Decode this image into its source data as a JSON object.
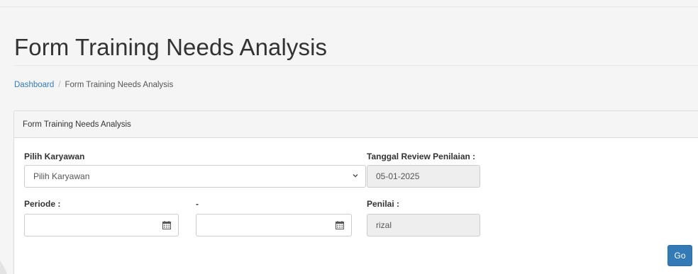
{
  "header": {
    "title": "Form Training Needs Analysis"
  },
  "breadcrumb": {
    "home": "Dashboard",
    "separator": "/",
    "current": "Form Training Needs Analysis"
  },
  "panel": {
    "heading": "Form Training Needs Analysis",
    "employee": {
      "label": "Pilih Karyawan",
      "selected": "Pilih Karyawan"
    },
    "period": {
      "label": "Periode :",
      "separator_label": "-",
      "start_value": "",
      "end_value": ""
    },
    "review_date": {
      "label": "Tanggal Review Penilaian :",
      "value": "05-01-2025"
    },
    "assessor": {
      "label": "Penilai :",
      "value": "rizal"
    },
    "go_label": "Go"
  },
  "colors": {
    "accent": "#337ab7",
    "readonly_bg": "#eeeeee",
    "page_bg": "#f5f5f5"
  },
  "icons": [
    "chevron-down-icon",
    "calendar-icon"
  ]
}
